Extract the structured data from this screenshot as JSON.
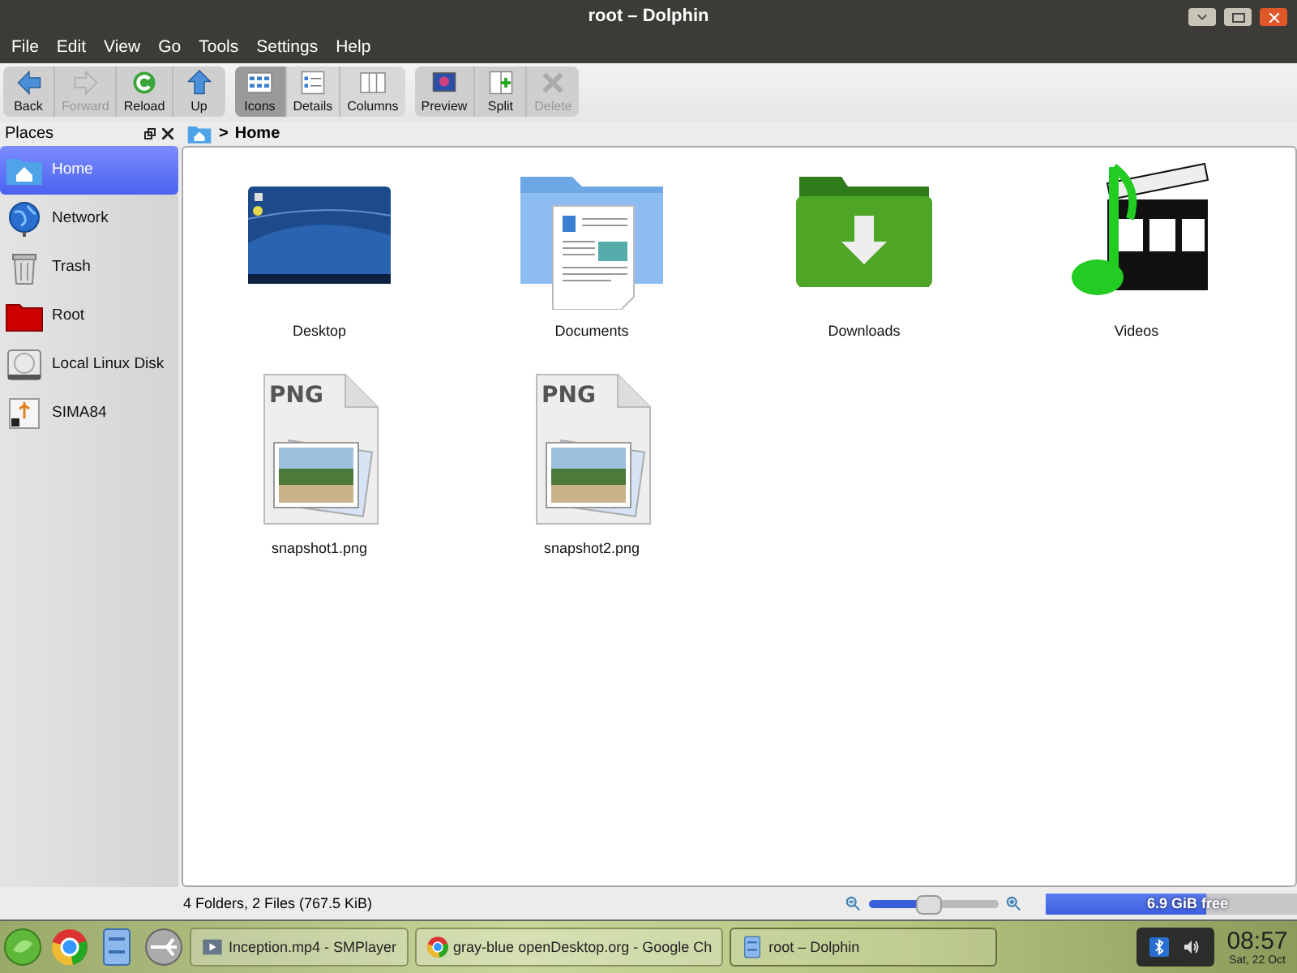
{
  "window": {
    "title": "root – Dolphin"
  },
  "menu": [
    "File",
    "Edit",
    "View",
    "Go",
    "Tools",
    "Settings",
    "Help"
  ],
  "toolbar": [
    {
      "kind": "nav",
      "buttons": [
        {
          "label": "Back",
          "disabled": false,
          "selected": false
        },
        {
          "label": "Forward",
          "disabled": true,
          "selected": false
        },
        {
          "label": "Reload",
          "disabled": false,
          "selected": false
        },
        {
          "label": "Up",
          "disabled": false,
          "selected": false
        }
      ]
    },
    {
      "kind": "view",
      "buttons": [
        {
          "label": "Icons",
          "disabled": false,
          "selected": true
        },
        {
          "label": "Details",
          "disabled": false,
          "selected": false
        },
        {
          "label": "Columns",
          "disabled": false,
          "selected": false
        }
      ]
    },
    {
      "kind": "tools",
      "buttons": [
        {
          "label": "Preview",
          "disabled": false,
          "selected": false
        },
        {
          "label": "Split",
          "disabled": false,
          "selected": false
        },
        {
          "label": "Delete",
          "disabled": true,
          "selected": false
        }
      ]
    }
  ],
  "places": {
    "title": "Places",
    "items": [
      {
        "label": "Home",
        "kind": "home",
        "selected": true
      },
      {
        "label": "Network",
        "kind": "network",
        "selected": false
      },
      {
        "label": "Trash",
        "kind": "trash",
        "selected": false
      },
      {
        "label": "Root",
        "kind": "folder",
        "selected": false
      },
      {
        "label": "Local Linux Disk",
        "kind": "disk",
        "selected": false
      },
      {
        "label": "SIMA84",
        "kind": "usb",
        "selected": false
      }
    ]
  },
  "breadcrumb": {
    "separator": ">",
    "location": "Home"
  },
  "files": [
    {
      "name": "Desktop",
      "kind": "desktop"
    },
    {
      "name": "Documents",
      "kind": "documents"
    },
    {
      "name": "Downloads",
      "kind": "downloads"
    },
    {
      "name": "Videos",
      "kind": "videos"
    },
    {
      "name": "snapshot1.png",
      "kind": "png",
      "badge": "PNG"
    },
    {
      "name": "snapshot2.png",
      "kind": "png",
      "badge": "PNG"
    }
  ],
  "status_bar": {
    "summary": "4 Folders, 2 Files (767.5 KiB)",
    "zoom": {
      "level": 0.45
    },
    "free_space": {
      "label": "6.9 GiB free",
      "level": 0.64
    }
  },
  "taskbar": {
    "tasks": [
      {
        "label": "Inception.mp4 - SMPlayer",
        "selected": false
      },
      {
        "label": "gray-blue openDesktop.org - Google Ch",
        "selected": false
      },
      {
        "label": "root – Dolphin",
        "selected": true
      }
    ],
    "clock": {
      "time": "08:57",
      "date": "Sat, 22 Oct"
    }
  }
}
